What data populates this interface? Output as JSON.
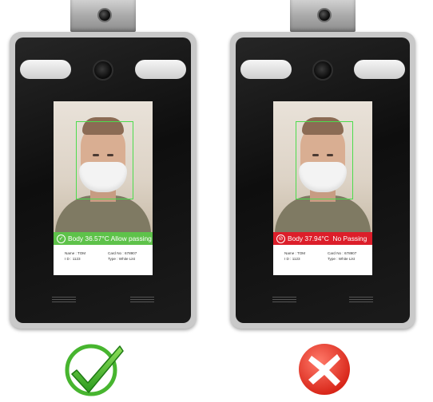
{
  "devices": [
    {
      "status_text": "Body 36.57°C Allow passing",
      "status_icon": "check-circle-icon",
      "status_color": "#5ec24a",
      "name_label": "Name :",
      "name_value": "TOM",
      "id_label": "I D :",
      "id_value": "1123",
      "card_label": "Card No :",
      "card_value": "678907",
      "type_label": "Type :",
      "type_value": "White List",
      "verdict_icon": "green-checkmark-icon"
    },
    {
      "status_text": "Body 37.94°C  No Passing",
      "status_icon": "prohibited-icon",
      "status_color": "#dc1e2a",
      "name_label": "Name :",
      "name_value": "TOM",
      "id_label": "I D :",
      "id_value": "1123",
      "card_label": "Card No :",
      "card_value": "678907",
      "type_label": "Type :",
      "type_value": "White List",
      "verdict_icon": "red-cross-icon"
    }
  ]
}
